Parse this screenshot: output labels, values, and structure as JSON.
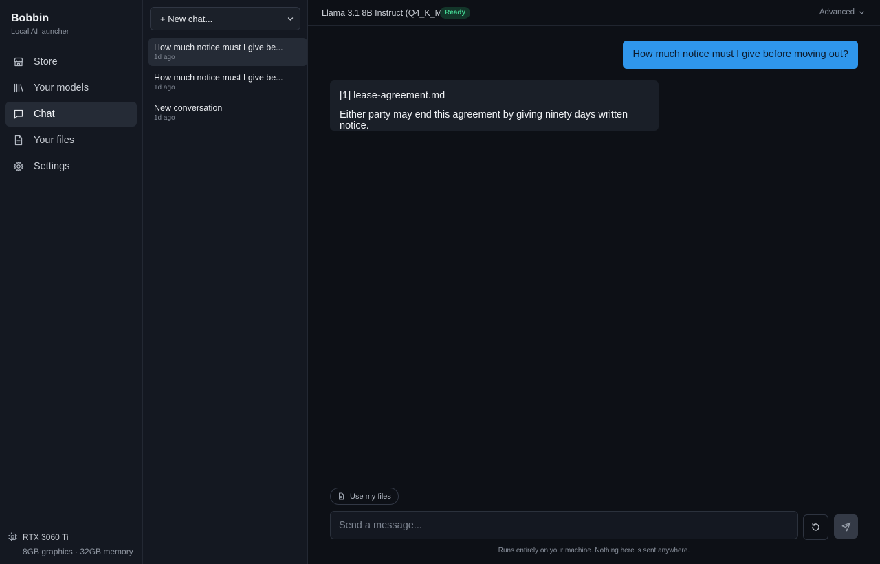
{
  "app": {
    "name": "Bobbin",
    "tagline": "Local AI launcher"
  },
  "nav": {
    "items": [
      {
        "label": "Store",
        "icon": "store-icon"
      },
      {
        "label": "Your models",
        "icon": "library-icon"
      },
      {
        "label": "Chat",
        "icon": "chat-bubble-icon",
        "active": true
      },
      {
        "label": "Your files",
        "icon": "file-icon"
      },
      {
        "label": "Settings",
        "icon": "gear-icon"
      }
    ]
  },
  "hardware": {
    "gpu": "RTX 3060 Ti",
    "specs": "8GB graphics · 32GB memory"
  },
  "chat_list": {
    "new_chat_label": "+ New chat...",
    "conversations": [
      {
        "title": "How much notice must I give be...",
        "time": "1d ago",
        "active": true
      },
      {
        "title": "How much notice must I give be...",
        "time": "1d ago"
      },
      {
        "title": "New conversation",
        "time": "1d ago"
      }
    ]
  },
  "header": {
    "model": "Llama 3.1 8B Instruct (Q4_K_M)",
    "status": "Ready",
    "advanced_label": "Advanced"
  },
  "messages": {
    "user": "How much notice must I give before moving out?",
    "assistant_citation": "[1] lease-agreement.md",
    "assistant_text": "Either party may end this agreement by giving ninety days written notice."
  },
  "composer": {
    "files_chip_label": "Use my files",
    "placeholder": "Send a message...",
    "value": "",
    "privacy_note": "Runs entirely on your machine. Nothing here is sent anywhere."
  },
  "colors": {
    "accent": "#2f96eb",
    "status_ready": "#43d492",
    "background": "#0d1016",
    "panel": "#141821"
  }
}
